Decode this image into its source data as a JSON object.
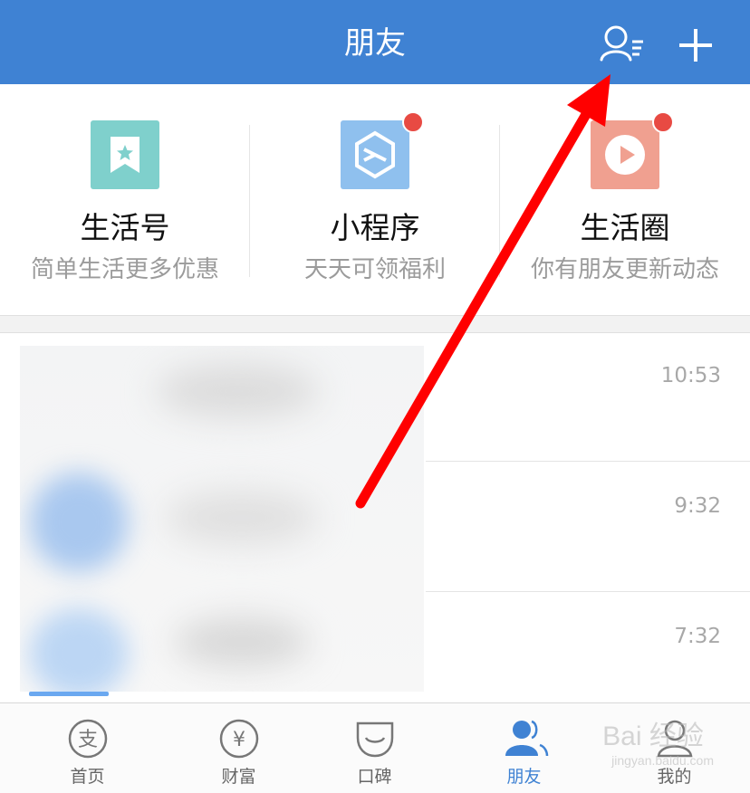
{
  "header": {
    "title": "朋友"
  },
  "entries": [
    {
      "name": "生活号",
      "desc": "简单生活更多优惠",
      "color": "#7fd0cc",
      "badge": false
    },
    {
      "name": "小程序",
      "desc": "天天可领福利",
      "color": "#8fc0ee",
      "badge": true
    },
    {
      "name": "生活圈",
      "desc": "你有朋友更新动态",
      "color": "#f0a090",
      "badge": true
    }
  ],
  "chats": [
    {
      "time": "10:53"
    },
    {
      "time": "9:32"
    },
    {
      "time": "7:32"
    }
  ],
  "tabs": [
    {
      "label": "首页",
      "icon": "alipay-icon"
    },
    {
      "label": "财富",
      "icon": "yen-icon"
    },
    {
      "label": "口碑",
      "icon": "koubei-icon"
    },
    {
      "label": "朋友",
      "icon": "friends-icon",
      "active": true
    },
    {
      "label": "我的",
      "icon": "profile-icon"
    }
  ],
  "watermark": {
    "main": "Bai 经验",
    "sub": "jingyan.baidu.com"
  },
  "colors": {
    "brand": "#3f82d3",
    "badge": "#e84a43",
    "arrow": "#ff0000"
  }
}
